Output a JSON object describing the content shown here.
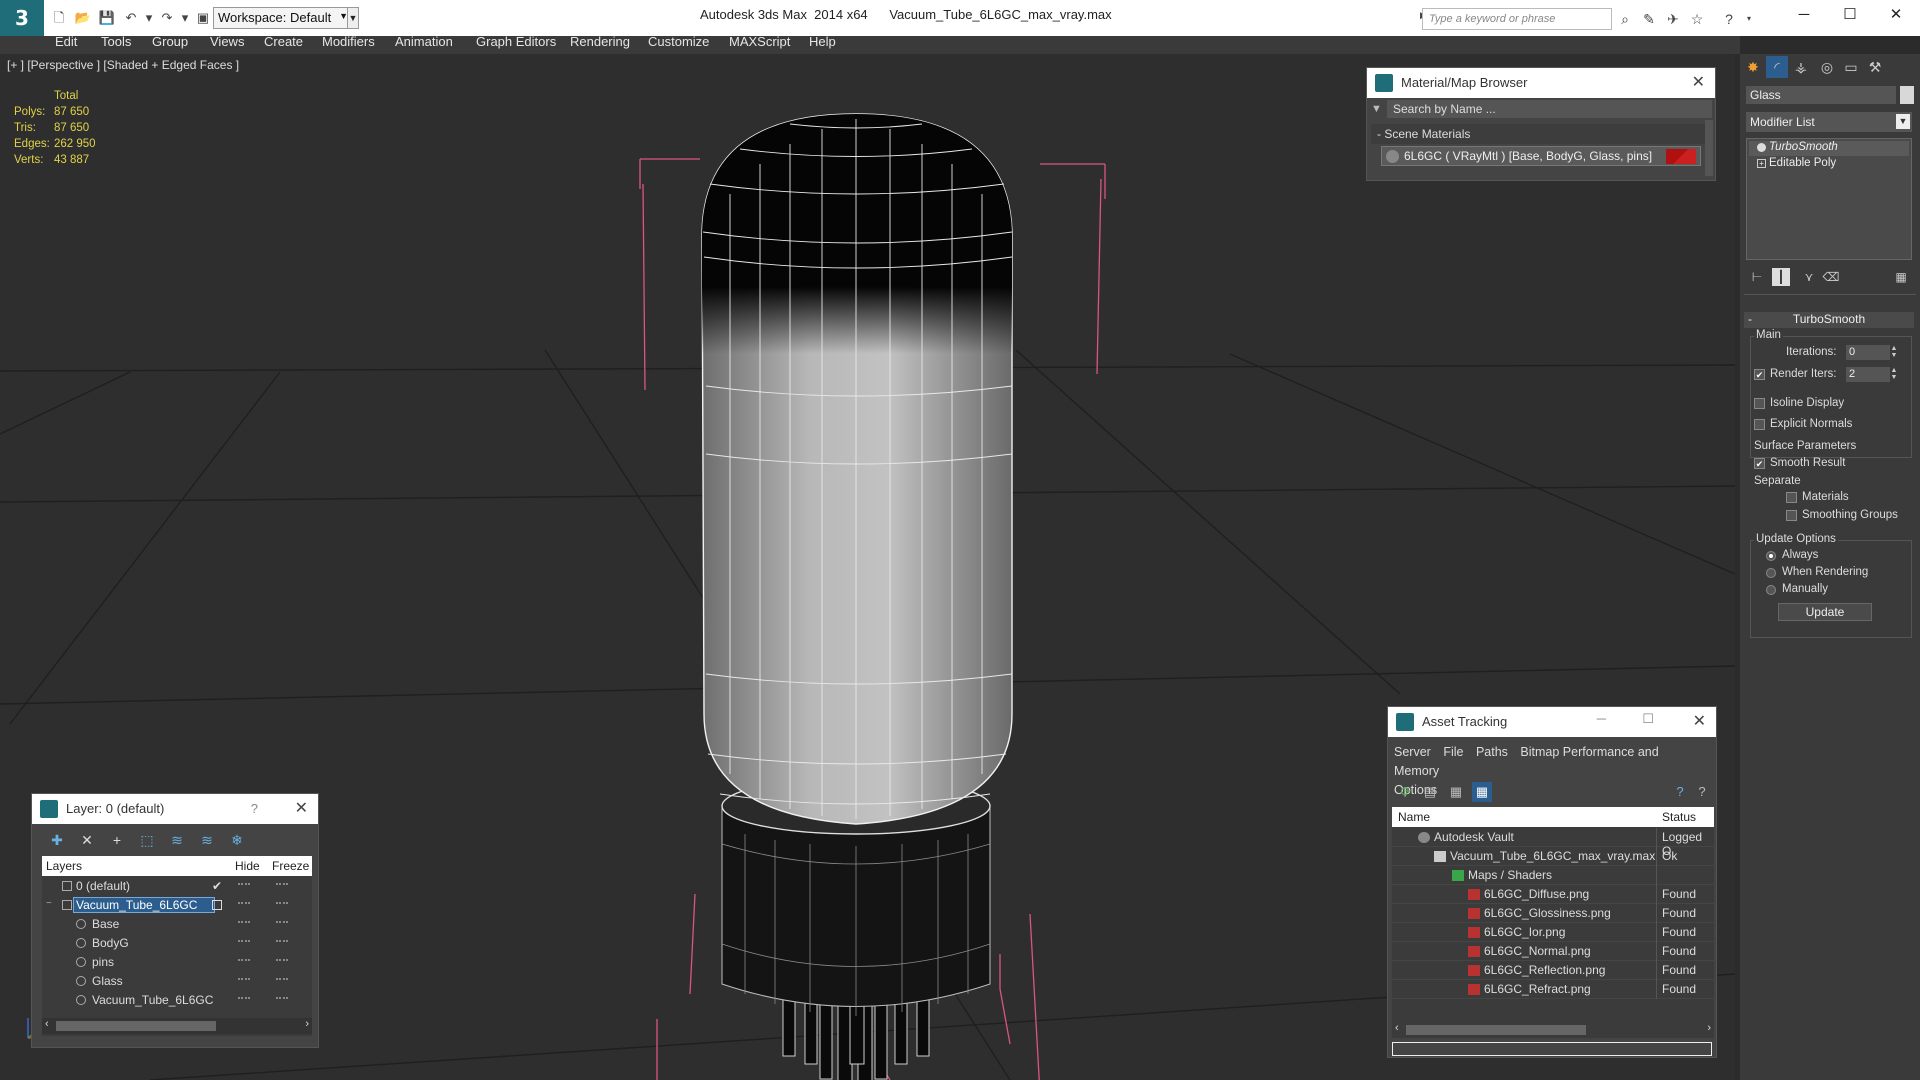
{
  "titlebar": {
    "app_title": "Autodesk 3ds Max  2014 x64      Vacuum_Tube_6L6GC_max_vray.max",
    "workspace": "Workspace: Default",
    "search_placeholder": "Type a keyword or phrase"
  },
  "menu": [
    "Edit",
    "Tools",
    "Group",
    "Views",
    "Create",
    "Modifiers",
    "Animation",
    "Graph Editors",
    "Rendering",
    "Customize",
    "MAXScript",
    "Help"
  ],
  "viewport": {
    "label": "[+ ] [Perspective ] [Shaded + Edged Faces ]",
    "stats": {
      "total_label": "Total",
      "polys_label": "Polys:",
      "polys": "87 650",
      "tris_label": "Tris:",
      "tris": "87 650",
      "edges_label": "Edges:",
      "edges": "262 950",
      "verts_label": "Verts:",
      "verts": "43 887"
    }
  },
  "material_browser": {
    "title": "Material/Map Browser",
    "search_placeholder": "Search by Name ...",
    "section": "- Scene Materials",
    "item": "6L6GC  ( VRayMtl ) [Base, BodyG, Glass, pins]",
    "swatch_color": "#b01010"
  },
  "layer_manager": {
    "title": "Layer: 0 (default)",
    "help": "?",
    "columns": {
      "layers": "Layers",
      "hide": "Hide",
      "freeze": "Freeze"
    },
    "rows": [
      {
        "name": "0 (default)",
        "active": true
      },
      {
        "name": "Vacuum_Tube_6L6GC",
        "selected": true
      },
      {
        "name": "Base"
      },
      {
        "name": "BodyG"
      },
      {
        "name": "pins"
      },
      {
        "name": "Glass"
      },
      {
        "name": "Vacuum_Tube_6L6GC"
      }
    ]
  },
  "asset_tracking": {
    "title": "Asset Tracking",
    "menu": [
      "Server",
      "File",
      "Paths",
      "Bitmap Performance and Memory",
      "Options"
    ],
    "columns": {
      "name": "Name",
      "status": "Status"
    },
    "rows": [
      {
        "name": "Autodesk Vault",
        "status": "Logged O"
      },
      {
        "name": "Vacuum_Tube_6L6GC_max_vray.max",
        "status": "Ok"
      },
      {
        "name": "Maps / Shaders",
        "status": ""
      },
      {
        "name": "6L6GC_Diffuse.png",
        "status": "Found"
      },
      {
        "name": "6L6GC_Glossiness.png",
        "status": "Found"
      },
      {
        "name": "6L6GC_Ior.png",
        "status": "Found"
      },
      {
        "name": "6L6GC_Normal.png",
        "status": "Found"
      },
      {
        "name": "6L6GC_Reflection.png",
        "status": "Found"
      },
      {
        "name": "6L6GC_Refract.png",
        "status": "Found"
      }
    ]
  },
  "command_panel": {
    "object_name": "Glass",
    "modifier_list": "Modifier List",
    "stack": [
      "TurboSmooth",
      "Editable Poly"
    ],
    "rollout_title": "TurboSmooth",
    "main_label": "Main",
    "iterations_label": "Iterations:",
    "iterations": "0",
    "render_iters_label": "Render Iters:",
    "render_iters": "2",
    "isoline_label": "Isoline Display",
    "explicit_normals_label": "Explicit Normals",
    "surface_params_label": "Surface Parameters",
    "smooth_result_label": "Smooth Result",
    "separate_label": "Separate",
    "materials_label": "Materials",
    "smoothing_groups_label": "Smoothing Groups",
    "update_options_label": "Update Options",
    "always_label": "Always",
    "when_rendering_label": "When Rendering",
    "manually_label": "Manually",
    "update_button": "Update",
    "render_iters_checked": true,
    "smooth_result_checked": true,
    "update_mode": "Always"
  }
}
